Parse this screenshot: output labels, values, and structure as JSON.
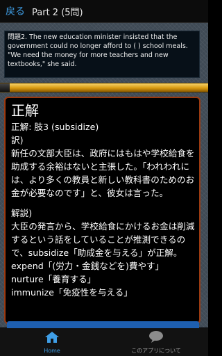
{
  "header": {
    "back_label": "戻る",
    "title": "Part 2 (5問)"
  },
  "question": {
    "text": "問題2. The new education minister insisted that the government could no longer afford to ( ) school meals. \"We need the money for more teachers and new textbooks,\" she said."
  },
  "answer": {
    "heading": "正解",
    "answer_line": "正解: 肢3 (subsidize)",
    "translation_label": "訳)",
    "translation": "新任の文部大臣は、政府にはもはや学校給食を助成する余裕はないと主張した。「われわれには、より多くの教員と新しい教科書のためのお金が必要なのです」と、彼女は言った。",
    "explanation_label": "解説)",
    "explanation": "大臣の発言から、学校給食にかけるお金は削減するという話をしていることが推測できるので、subsidize「助成金を与える」が正解。",
    "vocab": [
      "expend「(労力・金銭などを)費やす」",
      "nurture「養育する」",
      "immunize「免疫性を与える」"
    ]
  },
  "bottom_nav": {
    "home_label": "Home",
    "about_label": "このアプリについて"
  },
  "colors": {
    "accent_blue": "#3f9ee6",
    "panel_border": "#9b3a10",
    "gold_bar": "#d89a10"
  }
}
